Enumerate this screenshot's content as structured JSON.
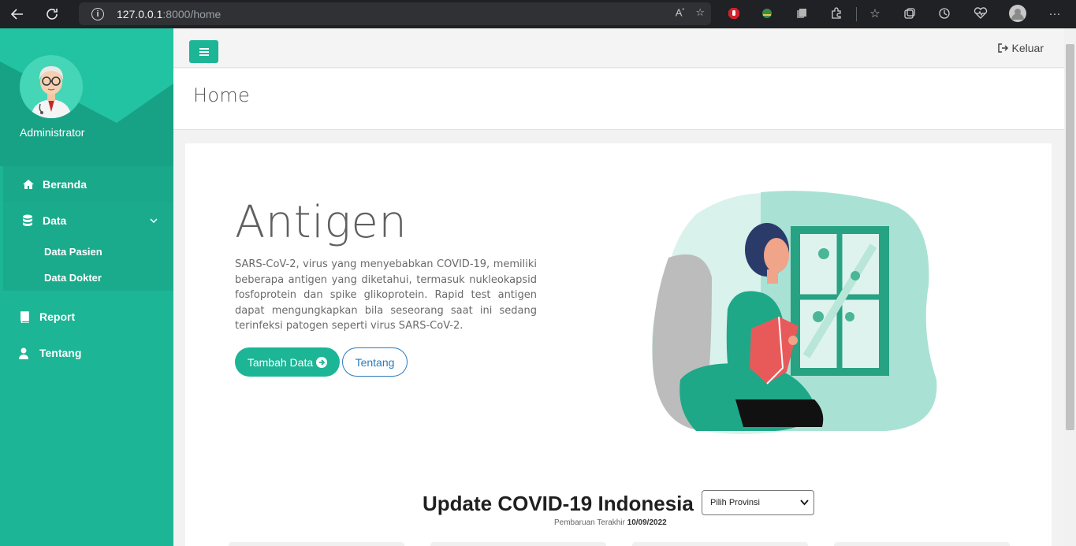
{
  "browser": {
    "url_host": "127.0.0.1",
    "url_rest": ":8000/home"
  },
  "sidebar": {
    "user_name": "Administrator",
    "items": [
      {
        "label": "Beranda",
        "icon": "home-icon"
      },
      {
        "label": "Data",
        "icon": "database-icon"
      },
      {
        "label": "Report",
        "icon": "book-icon"
      },
      {
        "label": "Tentang",
        "icon": "user-icon"
      }
    ],
    "data_submenu": [
      "Data Pasien",
      "Data Dokter"
    ]
  },
  "topbar": {
    "logout_label": "Keluar"
  },
  "page": {
    "title": "Home"
  },
  "hero": {
    "title": "Antigen",
    "text": "SARS-CoV-2, virus yang menyebabkan COVID-19, memiliki beberapa antigen yang diketahui, termasuk nukleokapsid fosfoprotein dan spike glikoprotein. Rapid test antigen dapat mengungkapkan bila seseorang saat ini sedang terinfeksi patogen seperti virus SARS-CoV-2.",
    "primary_button": "Tambah Data",
    "secondary_button": "Tentang"
  },
  "covid": {
    "title": "Update COVID-19 Indonesia",
    "province_select": "Pilih Provinsi",
    "updated_label": "Pembaruan Terakhir",
    "updated_date": "10/09/2022"
  },
  "colors": {
    "accent": "#1cb596",
    "outline_button": "#2a7bbd"
  }
}
